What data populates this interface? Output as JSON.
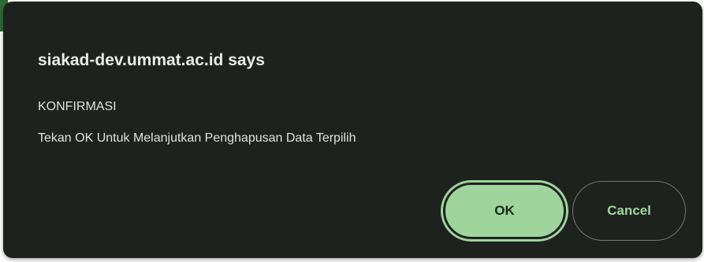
{
  "dialog": {
    "title": "siakad-dev.ummat.ac.id says",
    "message_lines": [
      "KONFIRMASI",
      "Tekan OK Untuk Melanjutkan Penghapusan Data Terpilih"
    ],
    "ok_label": "OK",
    "cancel_label": "Cancel"
  },
  "colors": {
    "dialog_background": "#1e221f",
    "accent": "#9fd59d",
    "text": "#e8ece8"
  }
}
